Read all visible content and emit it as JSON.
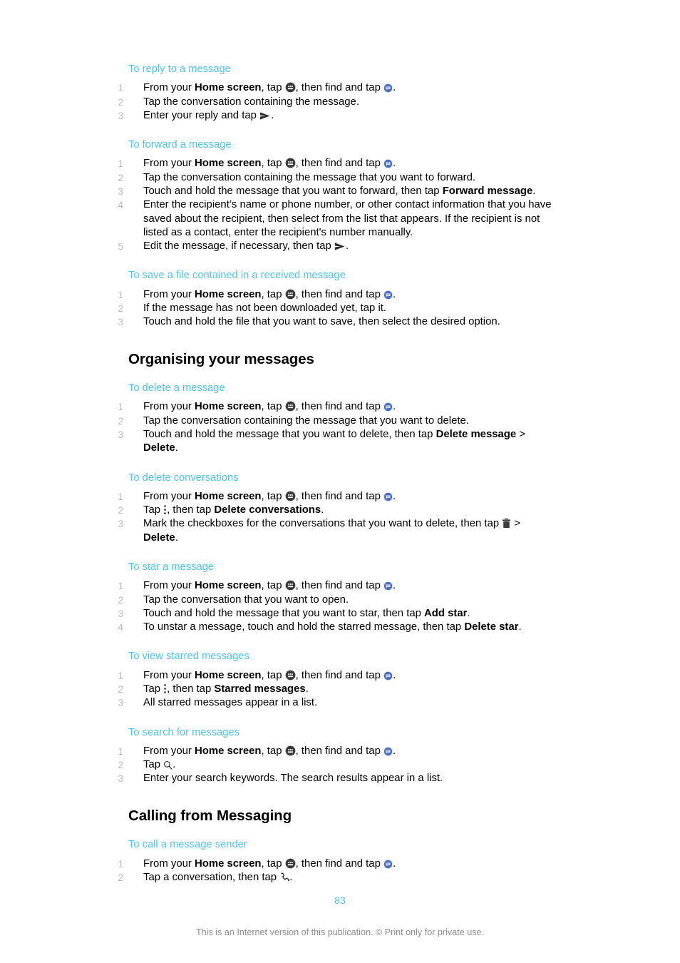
{
  "document": {
    "page_number": "83",
    "footer_note": "This is an Internet version of this publication. © Print only for private use.",
    "accent_color": "#4cc3e8",
    "text_color": "#000000",
    "number_color": "#b9b9b9",
    "footer_color": "#8b8b8b"
  },
  "sections": [
    {
      "heading": null,
      "procedures": [
        {
          "title": "To reply to a message",
          "steps": [
            {
              "num": "1",
              "html": "From your <b>Home screen</b>, tap <span class=\"ico\" data-name=\"app-drawer-icon\" data-interactable=\"false\">APPDRAWER</span>, then find and tap <span class=\"ico\" data-name=\"messaging-app-icon\" data-interactable=\"false\">MESSAGING</span>."
            },
            {
              "num": "2",
              "html": "Tap the conversation containing the message."
            },
            {
              "num": "3",
              "html": "Enter your reply and tap <span class=\"ico\" data-name=\"send-icon\" data-interactable=\"false\">SEND</span>."
            }
          ]
        },
        {
          "title": "To forward a message",
          "steps": [
            {
              "num": "1",
              "html": "From your <b>Home screen</b>, tap <span class=\"ico\" data-name=\"app-drawer-icon\" data-interactable=\"false\">APPDRAWER</span>, then find and tap <span class=\"ico\" data-name=\"messaging-app-icon\" data-interactable=\"false\">MESSAGING</span>."
            },
            {
              "num": "2",
              "html": "Tap the conversation containing the message that you want to forward."
            },
            {
              "num": "3",
              "html": "Touch and hold the message that you want to forward, then tap <b>Forward message</b>."
            },
            {
              "num": "4",
              "html": "Enter the recipient&rsquo;s name or phone number, or other contact information that you have saved about the recipient, then select from the list that appears. If the recipient is not listed as a contact, enter the recipient's number manually."
            },
            {
              "num": "5",
              "html": "Edit the message, if necessary, then tap <span class=\"ico\" data-name=\"send-icon\" data-interactable=\"false\">SEND</span>."
            }
          ]
        },
        {
          "title": "To save a file contained in a received message",
          "steps": [
            {
              "num": "1",
              "html": "From your <b>Home screen</b>, tap <span class=\"ico\" data-name=\"app-drawer-icon\" data-interactable=\"false\">APPDRAWER</span>, then find and tap <span class=\"ico\" data-name=\"messaging-app-icon\" data-interactable=\"false\">MESSAGING</span>."
            },
            {
              "num": "2",
              "html": "If the message has not been downloaded yet, tap it."
            },
            {
              "num": "3",
              "html": "Touch and hold the file that you want to save, then select the desired option."
            }
          ]
        }
      ]
    },
    {
      "heading": "Organising your messages",
      "procedures": [
        {
          "title": "To delete a message",
          "steps": [
            {
              "num": "1",
              "html": "From your <b>Home screen</b>, tap <span class=\"ico\" data-name=\"app-drawer-icon\" data-interactable=\"false\">APPDRAWER</span>, then find and tap <span class=\"ico\" data-name=\"messaging-app-icon\" data-interactable=\"false\">MESSAGING</span>."
            },
            {
              "num": "2",
              "html": "Tap the conversation containing the message that you want to delete."
            },
            {
              "num": "3",
              "html": "Touch and hold the message that you want to delete, then tap <b>Delete message</b> &gt; <b>Delete</b>."
            }
          ]
        },
        {
          "title": "To delete conversations",
          "steps": [
            {
              "num": "1",
              "html": "From your <b>Home screen</b>, tap <span class=\"ico\" data-name=\"app-drawer-icon\" data-interactable=\"false\">APPDRAWER</span>, then find and tap <span class=\"ico\" data-name=\"messaging-app-icon\" data-interactable=\"false\">MESSAGING</span>."
            },
            {
              "num": "2",
              "html": "Tap <span class=\"ico\" data-name=\"overflow-menu-icon\" data-interactable=\"false\">OVERFLOW</span>, then tap <b>Delete conversations</b>."
            },
            {
              "num": "3",
              "html": "Mark the checkboxes for the conversations that you want to delete, then tap <span class=\"ico\" data-name=\"trash-icon\" data-interactable=\"false\">TRASH</span> &gt; <b>Delete</b>."
            }
          ]
        },
        {
          "title": "To star a message",
          "steps": [
            {
              "num": "1",
              "html": "From your <b>Home screen</b>, tap <span class=\"ico\" data-name=\"app-drawer-icon\" data-interactable=\"false\">APPDRAWER</span>, then find and tap <span class=\"ico\" data-name=\"messaging-app-icon\" data-interactable=\"false\">MESSAGING</span>."
            },
            {
              "num": "2",
              "html": "Tap the conversation that you want to open."
            },
            {
              "num": "3",
              "html": "Touch and hold the message that you want to star, then tap <b>Add star</b>."
            },
            {
              "num": "4",
              "html": "To unstar a message, touch and hold the starred message, then tap <b>Delete star</b>."
            }
          ]
        },
        {
          "title": "To view starred messages",
          "steps": [
            {
              "num": "1",
              "html": "From your <b>Home screen</b>, tap <span class=\"ico\" data-name=\"app-drawer-icon\" data-interactable=\"false\">APPDRAWER</span>, then find and tap <span class=\"ico\" data-name=\"messaging-app-icon\" data-interactable=\"false\">MESSAGING</span>."
            },
            {
              "num": "2",
              "html": "Tap <span class=\"ico\" data-name=\"overflow-menu-icon\" data-interactable=\"false\">OVERFLOW</span>, then tap <b>Starred messages</b>."
            },
            {
              "num": "3",
              "html": "All starred messages appear in a list."
            }
          ]
        },
        {
          "title": "To search for messages",
          "steps": [
            {
              "num": "1",
              "html": "From your <b>Home screen</b>, tap <span class=\"ico\" data-name=\"app-drawer-icon\" data-interactable=\"false\">APPDRAWER</span>, then find and tap <span class=\"ico\" data-name=\"messaging-app-icon\" data-interactable=\"false\">MESSAGING</span>."
            },
            {
              "num": "2",
              "html": "Tap <span class=\"ico\" data-name=\"search-icon\" data-interactable=\"false\">SEARCH</span>."
            },
            {
              "num": "3",
              "html": "Enter your search keywords. The search results appear in a list."
            }
          ]
        }
      ]
    },
    {
      "heading": "Calling from Messaging",
      "procedures": [
        {
          "title": "To call a message sender",
          "steps": [
            {
              "num": "1",
              "html": "From your <b>Home screen</b>, tap <span class=\"ico\" data-name=\"app-drawer-icon\" data-interactable=\"false\">APPDRAWER</span>, then find and tap <span class=\"ico\" data-name=\"messaging-app-icon\" data-interactable=\"false\">MESSAGING</span>."
            },
            {
              "num": "2",
              "html": "Tap a conversation, then tap <span class=\"ico\" data-name=\"phone-call-icon\" data-interactable=\"false\">PHONE</span>."
            }
          ]
        }
      ]
    }
  ],
  "icons": {
    "app-drawer-icon": "app-drawer-icon",
    "messaging-app-icon": "messaging-app-icon",
    "send-icon": "send-icon",
    "overflow-menu-icon": "overflow-menu-icon",
    "trash-icon": "trash-icon",
    "search-icon": "search-icon",
    "phone-call-icon": "phone-call-icon"
  }
}
